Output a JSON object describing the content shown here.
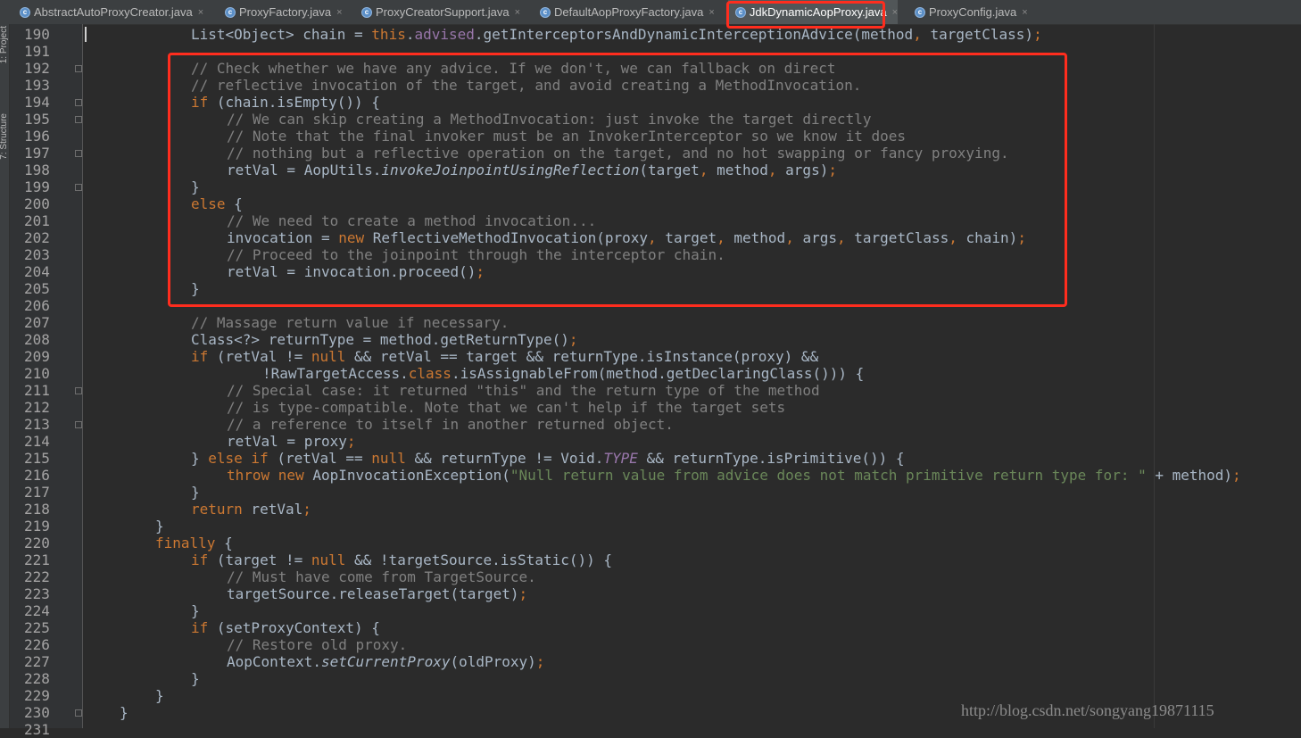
{
  "tabs": [
    {
      "label": "AbstractAutoProxyCreator.java",
      "active": false
    },
    {
      "label": "ProxyFactory.java",
      "active": false
    },
    {
      "label": "ProxyCreatorSupport.java",
      "active": false
    },
    {
      "label": "DefaultAopProxyFactory.java",
      "active": false
    },
    {
      "label": "JdkDynamicAopProxy.java",
      "active": true
    },
    {
      "label": "ProxyConfig.java",
      "active": false
    }
  ],
  "tab_close_glyph": "×",
  "tab_icon_glyph": "c",
  "side_panels": [
    "1: Project",
    "7: Structure"
  ],
  "line_numbers": [
    "190",
    "191",
    "192",
    "193",
    "194",
    "195",
    "196",
    "197",
    "198",
    "199",
    "200",
    "201",
    "202",
    "203",
    "204",
    "205",
    "206",
    "207",
    "208",
    "209",
    "210",
    "211",
    "212",
    "213",
    "214",
    "215",
    "216",
    "217",
    "218",
    "219",
    "220",
    "221",
    "222",
    "223",
    "224",
    "225",
    "226",
    "227",
    "228",
    "229",
    "230",
    "231"
  ],
  "code_lines": [
    {
      "indent": 4,
      "tokens": [
        [
          "t",
          "List<Object> chain = "
        ],
        [
          "k",
          "this"
        ],
        [
          "t",
          "."
        ],
        [
          "f",
          "advised"
        ],
        [
          "t",
          ".getInterceptorsAndDynamicInterceptionAdvice(method"
        ],
        [
          "k",
          ","
        ],
        [
          "t",
          " targetClass)"
        ],
        [
          "k",
          ";"
        ]
      ]
    },
    {
      "indent": 0,
      "tokens": []
    },
    {
      "indent": 4,
      "tokens": [
        [
          "c",
          "// Check whether we have any advice. If we don't, we can fallback on direct"
        ]
      ]
    },
    {
      "indent": 4,
      "tokens": [
        [
          "c",
          "// reflective invocation of the target, and avoid creating a MethodInvocation."
        ]
      ]
    },
    {
      "indent": 4,
      "tokens": [
        [
          "k",
          "if"
        ],
        [
          "t",
          " (chain.isEmpty()) {"
        ]
      ]
    },
    {
      "indent": 5,
      "tokens": [
        [
          "c",
          "// We can skip creating a MethodInvocation: just invoke the target directly"
        ]
      ]
    },
    {
      "indent": 5,
      "tokens": [
        [
          "c",
          "// Note that the final invoker must be an InvokerInterceptor so we know it does"
        ]
      ]
    },
    {
      "indent": 5,
      "tokens": [
        [
          "c",
          "// nothing but a reflective operation on the target, and no hot swapping or fancy proxying."
        ]
      ]
    },
    {
      "indent": 5,
      "tokens": [
        [
          "t",
          "retVal = AopUtils."
        ],
        [
          "i",
          "invokeJoinpointUsingReflection"
        ],
        [
          "t",
          "(target"
        ],
        [
          "k",
          ","
        ],
        [
          "t",
          " method"
        ],
        [
          "k",
          ","
        ],
        [
          "t",
          " args)"
        ],
        [
          "k",
          ";"
        ]
      ]
    },
    {
      "indent": 4,
      "tokens": [
        [
          "t",
          "}"
        ]
      ]
    },
    {
      "indent": 4,
      "tokens": [
        [
          "k",
          "else"
        ],
        [
          "t",
          " {"
        ]
      ]
    },
    {
      "indent": 5,
      "tokens": [
        [
          "c",
          "// We need to create a method invocation..."
        ]
      ]
    },
    {
      "indent": 5,
      "tokens": [
        [
          "t",
          "invocation = "
        ],
        [
          "k",
          "new"
        ],
        [
          "t",
          " ReflectiveMethodInvocation(proxy"
        ],
        [
          "k",
          ","
        ],
        [
          "t",
          " target"
        ],
        [
          "k",
          ","
        ],
        [
          "t",
          " method"
        ],
        [
          "k",
          ","
        ],
        [
          "t",
          " args"
        ],
        [
          "k",
          ","
        ],
        [
          "t",
          " targetClass"
        ],
        [
          "k",
          ","
        ],
        [
          "t",
          " chain)"
        ],
        [
          "k",
          ";"
        ]
      ]
    },
    {
      "indent": 5,
      "tokens": [
        [
          "c",
          "// Proceed to the joinpoint through the interceptor chain."
        ]
      ]
    },
    {
      "indent": 5,
      "tokens": [
        [
          "t",
          "retVal = invocation.proceed()"
        ],
        [
          "k",
          ";"
        ]
      ]
    },
    {
      "indent": 4,
      "tokens": [
        [
          "t",
          "}"
        ]
      ]
    },
    {
      "indent": 0,
      "tokens": []
    },
    {
      "indent": 4,
      "tokens": [
        [
          "c",
          "// Massage return value if necessary."
        ]
      ]
    },
    {
      "indent": 4,
      "tokens": [
        [
          "t",
          "Class<?> returnType = method.getReturnType()"
        ],
        [
          "k",
          ";"
        ]
      ]
    },
    {
      "indent": 4,
      "tokens": [
        [
          "k",
          "if"
        ],
        [
          "t",
          " (retVal != "
        ],
        [
          "k",
          "null"
        ],
        [
          "t",
          " && retVal == target && returnType.isInstance(proxy) &&"
        ]
      ]
    },
    {
      "indent": 6,
      "tokens": [
        [
          "t",
          "!RawTargetAccess."
        ],
        [
          "k",
          "class"
        ],
        [
          "t",
          ".isAssignableFrom(method.getDeclaringClass())) {"
        ]
      ]
    },
    {
      "indent": 5,
      "tokens": [
        [
          "c",
          "// Special case: it returned \"this\" and the return type of the method"
        ]
      ]
    },
    {
      "indent": 5,
      "tokens": [
        [
          "c",
          "// is type-compatible. Note that we can't help if the target sets"
        ]
      ]
    },
    {
      "indent": 5,
      "tokens": [
        [
          "c",
          "// a reference to itself in another returned object."
        ]
      ]
    },
    {
      "indent": 5,
      "tokens": [
        [
          "t",
          "retVal = proxy"
        ],
        [
          "k",
          ";"
        ]
      ]
    },
    {
      "indent": 4,
      "tokens": [
        [
          "t",
          "} "
        ],
        [
          "k",
          "else if"
        ],
        [
          "t",
          " (retVal == "
        ],
        [
          "k",
          "null"
        ],
        [
          "t",
          " && returnType != Void."
        ],
        [
          "fi",
          "TYPE"
        ],
        [
          "t",
          " && returnType.isPrimitive()) {"
        ]
      ]
    },
    {
      "indent": 5,
      "tokens": [
        [
          "k",
          "throw new"
        ],
        [
          "t",
          " AopInvocationException("
        ],
        [
          "s",
          "\"Null return value from advice does not match primitive return type for: \""
        ],
        [
          "t",
          " + method)"
        ],
        [
          "k",
          ";"
        ]
      ]
    },
    {
      "indent": 4,
      "tokens": [
        [
          "t",
          "}"
        ]
      ]
    },
    {
      "indent": 4,
      "tokens": [
        [
          "k",
          "return"
        ],
        [
          "t",
          " retVal"
        ],
        [
          "k",
          ";"
        ]
      ]
    },
    {
      "indent": 3,
      "tokens": [
        [
          "t",
          "}"
        ]
      ]
    },
    {
      "indent": 3,
      "tokens": [
        [
          "k",
          "finally"
        ],
        [
          "t",
          " {"
        ]
      ]
    },
    {
      "indent": 4,
      "tokens": [
        [
          "k",
          "if"
        ],
        [
          "t",
          " (target != "
        ],
        [
          "k",
          "null"
        ],
        [
          "t",
          " && !targetSource.isStatic()) {"
        ]
      ]
    },
    {
      "indent": 5,
      "tokens": [
        [
          "c",
          "// Must have come from TargetSource."
        ]
      ]
    },
    {
      "indent": 5,
      "tokens": [
        [
          "t",
          "targetSource.releaseTarget(target)"
        ],
        [
          "k",
          ";"
        ]
      ]
    },
    {
      "indent": 4,
      "tokens": [
        [
          "t",
          "}"
        ]
      ]
    },
    {
      "indent": 4,
      "tokens": [
        [
          "k",
          "if"
        ],
        [
          "t",
          " (setProxyContext) {"
        ]
      ]
    },
    {
      "indent": 5,
      "tokens": [
        [
          "c",
          "// Restore old proxy."
        ]
      ]
    },
    {
      "indent": 5,
      "tokens": [
        [
          "t",
          "AopContext."
        ],
        [
          "i",
          "setCurrentProxy"
        ],
        [
          "t",
          "(oldProxy)"
        ],
        [
          "k",
          ";"
        ]
      ]
    },
    {
      "indent": 4,
      "tokens": [
        [
          "t",
          "}"
        ]
      ]
    },
    {
      "indent": 3,
      "tokens": [
        [
          "t",
          "}"
        ]
      ]
    },
    {
      "indent": 2,
      "tokens": [
        [
          "t",
          "}"
        ]
      ]
    },
    {
      "indent": 0,
      "tokens": []
    }
  ],
  "fold_marker_lines": [
    2,
    4,
    5,
    7,
    9,
    21,
    23,
    40
  ],
  "watermark": "http://blog.csdn.net/songyang19871115",
  "colors": {
    "background": "#2b2b2b",
    "keyword": "#cc7832",
    "comment": "#808080",
    "string": "#6a8759",
    "field": "#9876aa",
    "text": "#a9b7c6",
    "annotation_red": "#ff2d1e"
  }
}
